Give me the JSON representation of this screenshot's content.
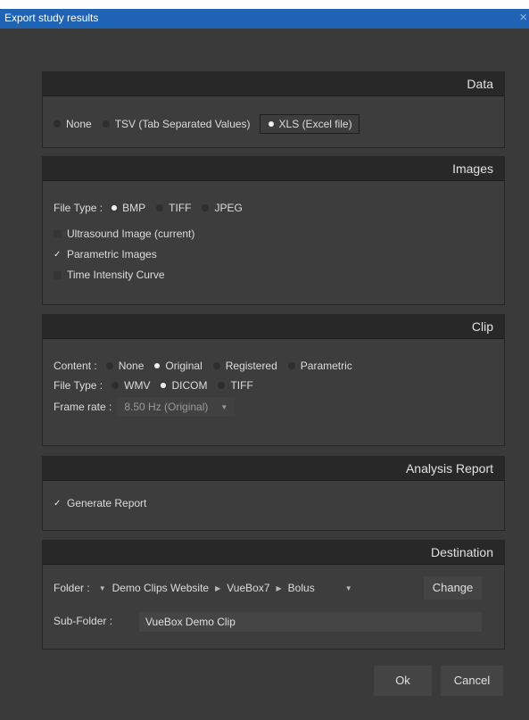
{
  "window": {
    "title": "Export study results",
    "close_glyph": "×"
  },
  "data_section": {
    "title": "Data",
    "options": [
      "None",
      "TSV (Tab Separated Values)",
      "XLS (Excel file)"
    ],
    "selected": "XLS (Excel file)"
  },
  "images_section": {
    "title": "Images",
    "file_type_label": "File Type :",
    "file_types": [
      "BMP",
      "TIFF",
      "JPEG"
    ],
    "selected_type": "BMP",
    "checkboxes": [
      {
        "label": "Ultrasound Image (current)",
        "checked": false
      },
      {
        "label": "Parametric Images",
        "checked": true
      },
      {
        "label": "Time Intensity Curve",
        "checked": false
      }
    ]
  },
  "clip_section": {
    "title": "Clip",
    "content_label": "Content :",
    "content_options": [
      "None",
      "Original",
      "Registered",
      "Parametric"
    ],
    "content_selected": "Original",
    "file_type_label": "File Type :",
    "file_types": [
      "WMV",
      "DICOM",
      "TIFF"
    ],
    "file_type_selected": "DICOM",
    "frame_rate_label": "Frame rate :",
    "frame_rate_value": "8.50 Hz (Original)"
  },
  "analysis_section": {
    "title": "Analysis Report",
    "generate_label": "Generate Report",
    "generate_checked": true
  },
  "destination_section": {
    "title": "Destination",
    "folder_label": "Folder :",
    "folder_path": [
      "Demo Clips Website",
      "VueBox7",
      "Bolus"
    ],
    "change_label": "Change",
    "subfolder_label": "Sub-Folder :",
    "subfolder_value": "VueBox Demo Clip"
  },
  "buttons": {
    "ok": "Ok",
    "cancel": "Cancel"
  }
}
